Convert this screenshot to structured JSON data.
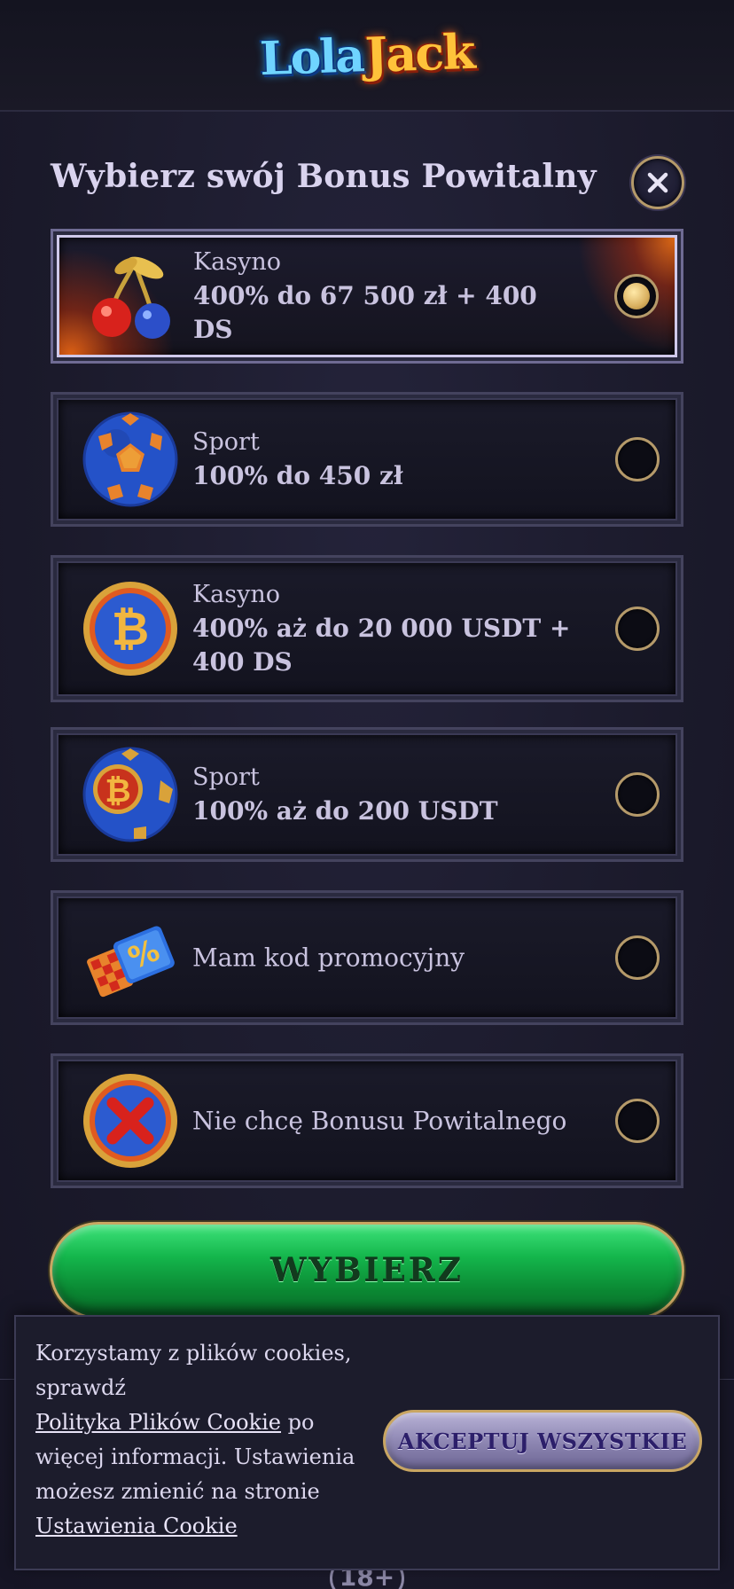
{
  "header": {
    "logo": {
      "part1": "Lola",
      "part2": "Jack"
    }
  },
  "dialog": {
    "title": "Wybierz swój Bonus Powitalny",
    "close_icon": "close-icon"
  },
  "options": [
    {
      "icon": "cherries-icon",
      "category": "Kasyno",
      "amount": "400% do 67 500 zł + 400 DS",
      "selected": true
    },
    {
      "icon": "football-icon",
      "category": "Sport",
      "amount": "100% do 450 zł",
      "selected": false
    },
    {
      "icon": "bitcoin-coin-icon",
      "category": "Kasyno",
      "amount": "400% aż do 20 000 USDT + 400 DS",
      "selected": false
    },
    {
      "icon": "bitcoin-football-icon",
      "category": "Sport",
      "amount": "100% aż do 200 USDT",
      "selected": false
    },
    {
      "icon": "promo-ticket-icon",
      "label": "Mam kod promocyjny",
      "selected": false
    },
    {
      "icon": "no-bonus-coin-icon",
      "label": "Nie chcę Bonusu Powitalnego",
      "selected": false
    }
  ],
  "choose_button": {
    "label": "WYBIERZ"
  },
  "cookie_banner": {
    "text_before": "Korzystamy z plików cookies, sprawdź",
    "policy_link": "Polityka Plików Cookie",
    "text_middle": " po więcej informacji. Ustawienia możesz zmienić na stronie",
    "settings_link": "Ustawienia Cookie",
    "accept_label": "AKCEPTUJ WSZYSTKIE"
  },
  "footer": {
    "age_badge": "18+"
  },
  "colors": {
    "background": "#1c1b2c",
    "accent_gold": "#c9a662",
    "button_green": "#14b64c",
    "text_light": "#c9c3df"
  }
}
